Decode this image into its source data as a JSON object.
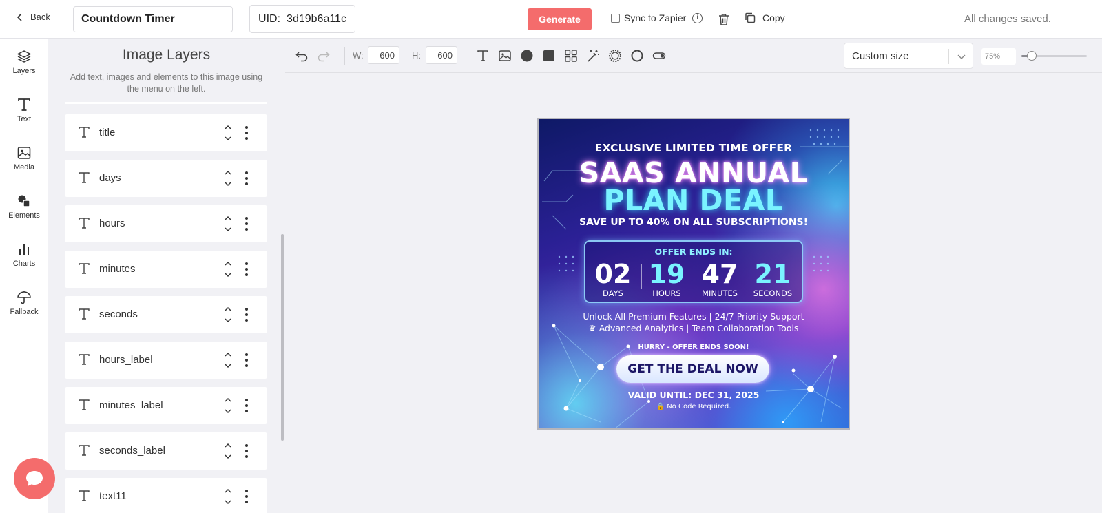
{
  "topbar": {
    "back_label": "Back",
    "template_name": "Countdown Timer",
    "uid_label": "UID:",
    "uid_value": "3d19b6a11c",
    "generate_label": "Generate",
    "sync_label": "Sync to Zapier",
    "copy_label": "Copy",
    "status": "All changes saved."
  },
  "rail": {
    "items": [
      {
        "label": "Layers",
        "icon": "layers-icon"
      },
      {
        "label": "Text",
        "icon": "text-icon"
      },
      {
        "label": "Media",
        "icon": "image-icon"
      },
      {
        "label": "Elements",
        "icon": "shapes-icon"
      },
      {
        "label": "Charts",
        "icon": "bar-chart-icon"
      },
      {
        "label": "Fallback",
        "icon": "umbrella-icon"
      }
    ]
  },
  "panel": {
    "title": "Image Layers",
    "subtitle": "Add text, images and elements to this image using the menu on the left.",
    "layers": [
      "title",
      "days",
      "hours",
      "minutes",
      "seconds",
      "hours_label",
      "minutes_label",
      "seconds_label",
      "text11"
    ]
  },
  "toolbar": {
    "width_label": "W:",
    "width_value": "600",
    "height_label": "H:",
    "height_value": "600",
    "size_preset": "Custom size",
    "zoom": "75%",
    "zoom_level": 0.75
  },
  "poster": {
    "kicker": "EXCLUSIVE LIMITED TIME OFFER",
    "title_line1": "SAAS ANNUAL",
    "title_line2": "PLAN DEAL",
    "savings": "SAVE UP TO 40% ON ALL SUBSCRIPTIONS!",
    "countdown_heading": "OFFER ENDS IN:",
    "countdown": [
      {
        "value": "02",
        "label": "DAYS"
      },
      {
        "value": "19",
        "label": "HOURS"
      },
      {
        "value": "47",
        "label": "MINUTES"
      },
      {
        "value": "21",
        "label": "SECONDS"
      }
    ],
    "features_line1": "Unlock All Premium Features  |  24/7 Priority Support",
    "features_line2": "♛ Advanced Analytics  |  Team Collaboration Tools",
    "hurry": "HURRY - OFFER ENDS SOON!",
    "cta": "GET THE DEAL NOW",
    "valid_until": "VALID UNTIL: DEC 31, 2025",
    "no_code": "🔒 No Code Required."
  },
  "colors": {
    "accent": "#f46c6c",
    "title_cyan": "#7af3ff",
    "poster_navy": "#0e1966"
  }
}
